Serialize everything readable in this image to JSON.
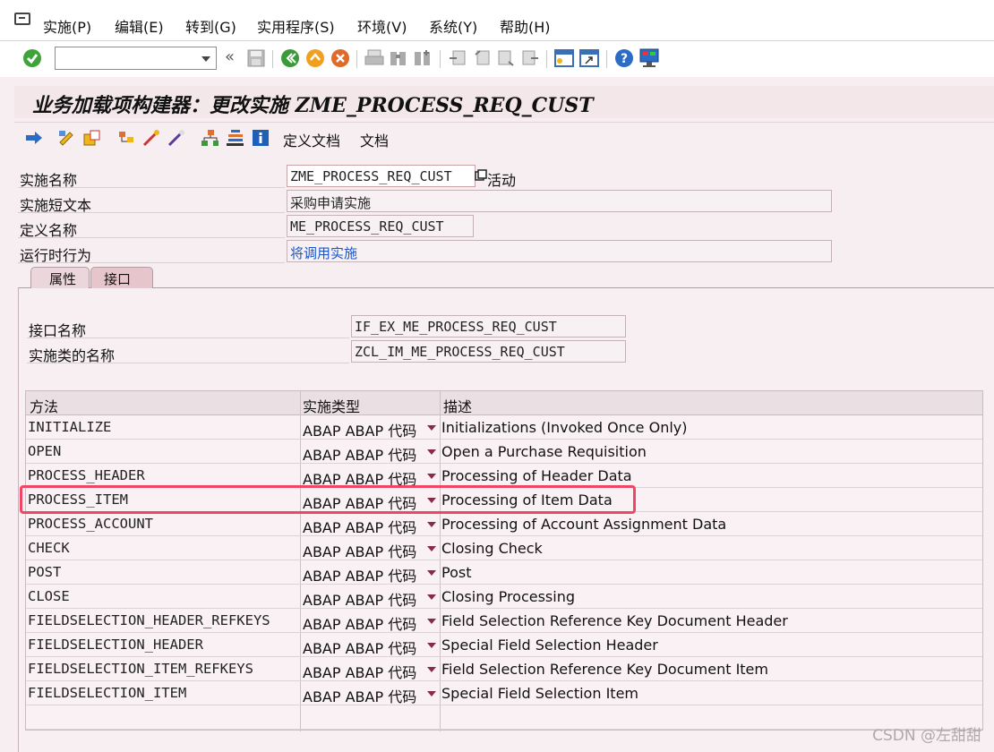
{
  "menu": {
    "items": [
      "实施(P)",
      "编辑(E)",
      "转到(G)",
      "实用程序(S)",
      "环境(V)",
      "系统(Y)",
      "帮助(H)"
    ]
  },
  "toolbar": {
    "command_field_value": "",
    "collapse_symbol": "«"
  },
  "title": "业务加载项构建器：更改实施 ZME_PROCESS_REQ_CUST",
  "app_toolbar": {
    "define_doc_label": "定义文档",
    "doc_label": "文档"
  },
  "header": {
    "impl_name_label": "实施名称",
    "impl_name_value": "ZME_PROCESS_REQ_CUST",
    "active_label": "活动",
    "short_text_label": "实施短文本",
    "short_text_value": "采购申请实施",
    "def_name_label": "定义名称",
    "def_name_value": "ME_PROCESS_REQ_CUST",
    "runtime_label": "运行时行为",
    "runtime_value": "将调用实施"
  },
  "tabs": [
    {
      "label": "属性",
      "active": false
    },
    {
      "label": "接口",
      "active": true
    }
  ],
  "interface": {
    "iface_name_label": "接口名称",
    "iface_name_value": "IF_EX_ME_PROCESS_REQ_CUST",
    "class_name_label": "实施类的名称",
    "class_name_value": "ZCL_IM_ME_PROCESS_REQ_CUST"
  },
  "grid": {
    "headers": [
      "方法",
      "实施类型",
      "描述"
    ],
    "rows": [
      {
        "method": "INITIALIZE",
        "type": "ABAP ABAP 代码",
        "desc": "Initializations (Invoked Once Only)"
      },
      {
        "method": "OPEN",
        "type": "ABAP ABAP 代码",
        "desc": "Open a Purchase Requisition"
      },
      {
        "method": "PROCESS_HEADER",
        "type": "ABAP ABAP 代码",
        "desc": "Processing of Header Data"
      },
      {
        "method": "PROCESS_ITEM",
        "type": "ABAP ABAP 代码",
        "desc": "Processing of Item Data"
      },
      {
        "method": "PROCESS_ACCOUNT",
        "type": "ABAP ABAP 代码",
        "desc": "Processing of Account Assignment Data"
      },
      {
        "method": "CHECK",
        "type": "ABAP ABAP 代码",
        "desc": "Closing Check"
      },
      {
        "method": "POST",
        "type": "ABAP ABAP 代码",
        "desc": "Post"
      },
      {
        "method": "CLOSE",
        "type": "ABAP ABAP 代码",
        "desc": "Closing Processing"
      },
      {
        "method": "FIELDSELECTION_HEADER_REFKEYS",
        "type": "ABAP ABAP 代码",
        "desc": "Field Selection Reference Key Document Header"
      },
      {
        "method": "FIELDSELECTION_HEADER",
        "type": "ABAP ABAP 代码",
        "desc": "Special Field Selection Header"
      },
      {
        "method": "FIELDSELECTION_ITEM_REFKEYS",
        "type": "ABAP ABAP 代码",
        "desc": "Field Selection Reference Key Document Item"
      },
      {
        "method": "FIELDSELECTION_ITEM",
        "type": "ABAP ABAP 代码",
        "desc": "Special Field Selection Item"
      }
    ]
  },
  "watermark": "CSDN @左甜甜",
  "colors": {
    "highlight": "#ef4665",
    "link": "#1a55c8",
    "background": "#f6eef0"
  }
}
